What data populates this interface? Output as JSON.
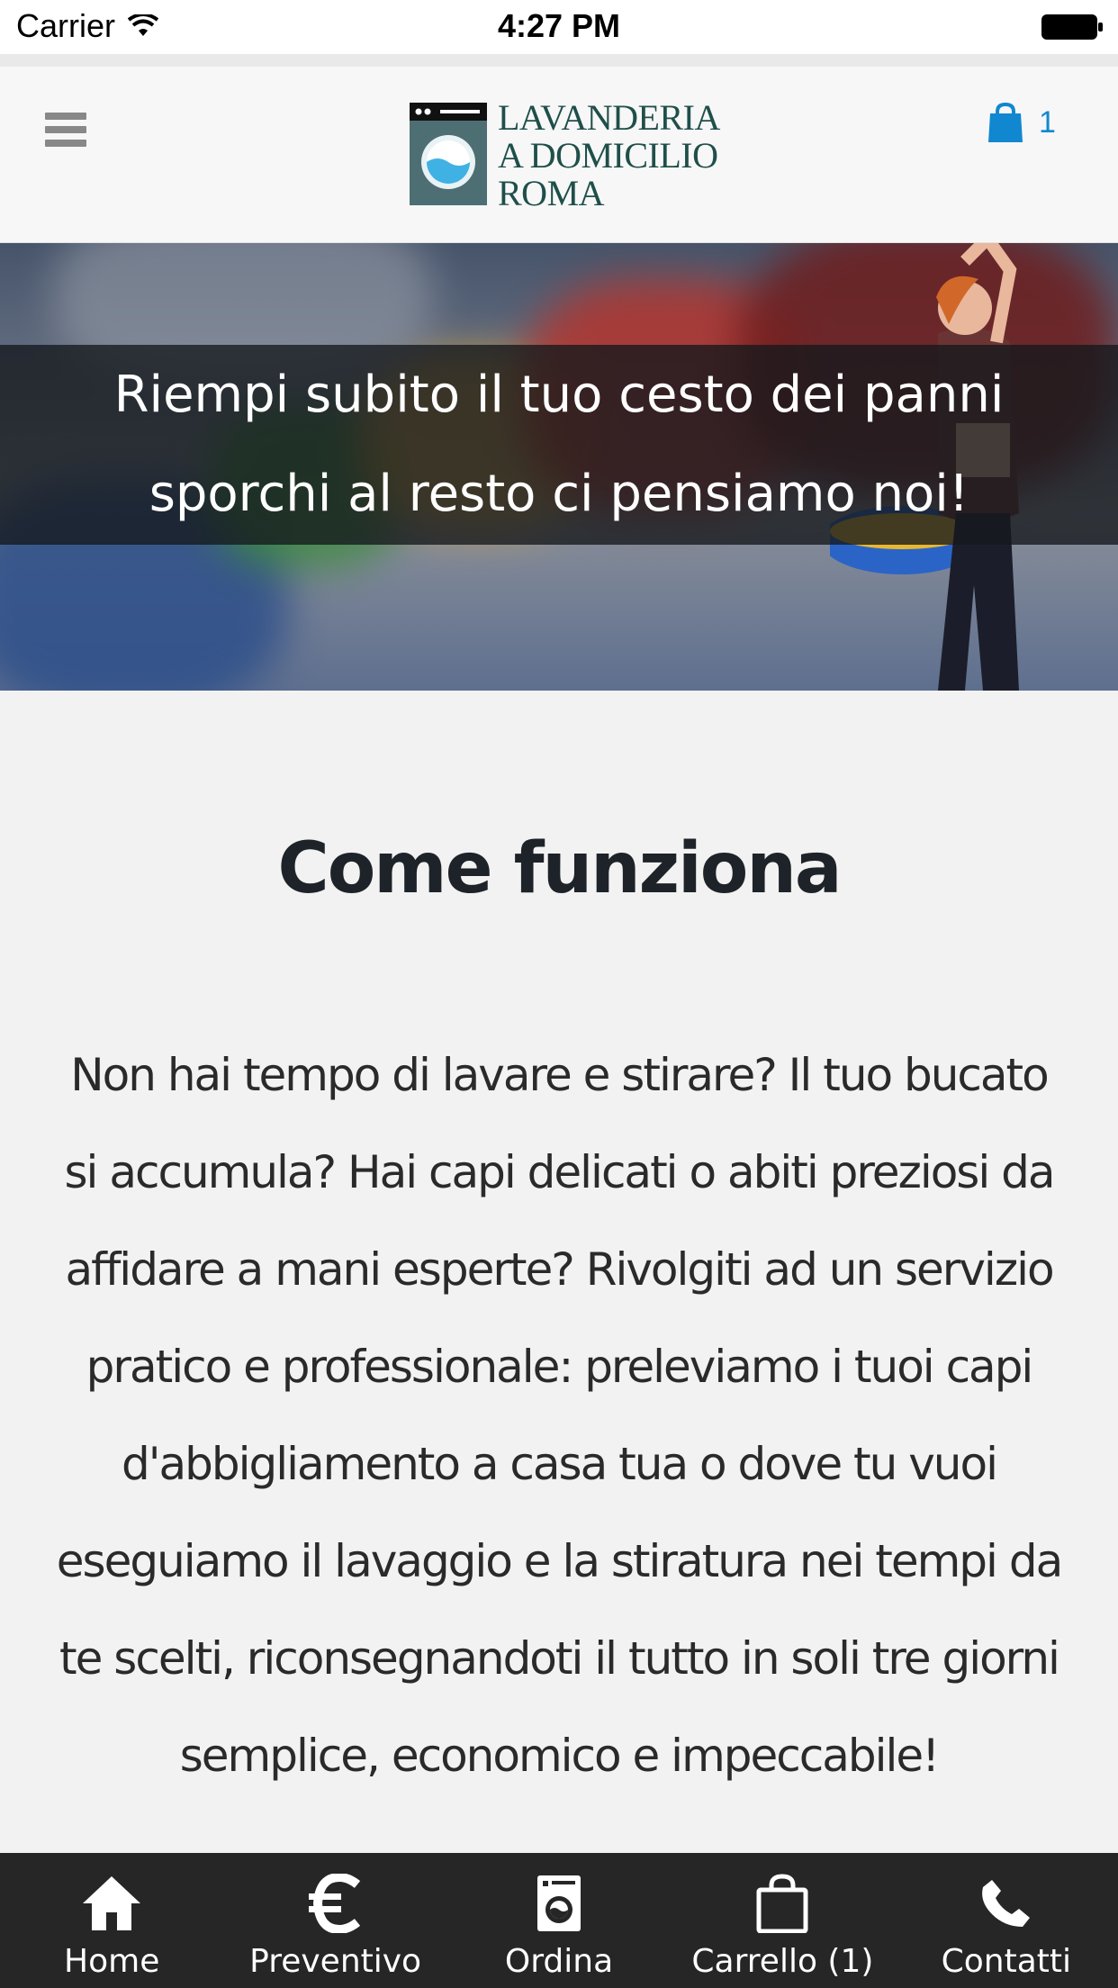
{
  "status_bar": {
    "carrier": "Carrier",
    "time": "4:27 PM"
  },
  "header": {
    "logo_lines": [
      "LAVANDERIA",
      "A DOMICILIO",
      "ROMA"
    ],
    "cart_count": "1",
    "accent_color": "#1187d0",
    "logo_color": "#1f4f4a"
  },
  "hero": {
    "caption": "Riempi subito il tuo cesto dei panni sporchi al resto ci pensiamo noi!"
  },
  "main": {
    "title": "Come funziona",
    "body": "Non hai tempo di lavare e stirare? Il tuo bucato si accumula? Hai capi delicati o abiti preziosi da affidare a mani esperte? Rivolgiti ad un servizio pratico e professionale: preleviamo i tuoi capi d'abbigliamento a casa tua o dove tu vuoi eseguiamo il lavaggio e la stiratura nei tempi da te scelti, riconsegnandoti il tutto in soli tre giorni semplice, economico e impeccabile!"
  },
  "tabs": [
    {
      "label": "Home",
      "icon": "home-icon"
    },
    {
      "label": "Preventivo",
      "icon": "euro-icon"
    },
    {
      "label": "Ordina",
      "icon": "washing-machine-icon"
    },
    {
      "label": "Carrello (1)",
      "icon": "shopping-bag-icon"
    },
    {
      "label": "Contatti",
      "icon": "phone-icon"
    }
  ]
}
